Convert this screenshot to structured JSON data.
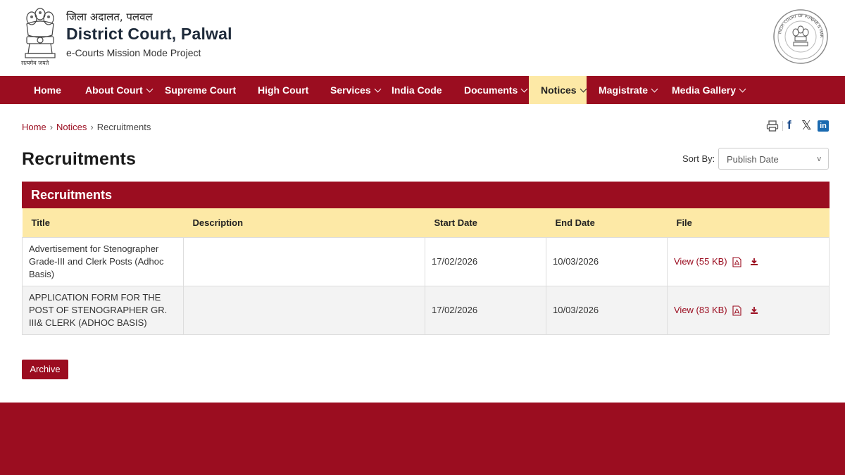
{
  "header": {
    "hindi_title": "जिला अदालत, पलवल",
    "title": "District Court, Palwal",
    "subtitle": "e-Courts Mission Mode Project",
    "emblem_motto": "सत्यमेव जयते"
  },
  "nav": {
    "items": [
      {
        "label": "Home",
        "has_dropdown": false
      },
      {
        "label": "About Court",
        "has_dropdown": true
      },
      {
        "label": "Supreme Court",
        "has_dropdown": false
      },
      {
        "label": "High Court",
        "has_dropdown": false
      },
      {
        "label": "Services",
        "has_dropdown": true
      },
      {
        "label": "India Code",
        "has_dropdown": false
      },
      {
        "label": "Documents",
        "has_dropdown": true
      },
      {
        "label": "Notices",
        "has_dropdown": true,
        "active": true
      },
      {
        "label": "Magistrate",
        "has_dropdown": true
      },
      {
        "label": "Media Gallery",
        "has_dropdown": true
      }
    ]
  },
  "breadcrumb": {
    "home": "Home",
    "notices": "Notices",
    "current": "Recruitments",
    "separator": "›"
  },
  "share": {
    "print_icon": "printer-icon",
    "facebook": "f",
    "x": "𝕏",
    "linkedin": "in"
  },
  "page": {
    "title": "Recruitments",
    "sort_label": "Sort By:",
    "sort_value": "Publish Date",
    "sort_caret": "v"
  },
  "table": {
    "panel_title": "Recruitments",
    "headers": {
      "title": "Title",
      "description": "Description",
      "start_date": "Start Date",
      "end_date": "End Date",
      "file": "File"
    },
    "rows": [
      {
        "title": "Advertisement for Stenographer Grade-III and Clerk Posts (Adhoc Basis)",
        "description": "",
        "start_date": "17/02/2026",
        "end_date": "10/03/2026",
        "file": "View (55 KB)"
      },
      {
        "title": "APPLICATION FORM FOR THE POST OF STENOGRAPHER GR. III& CLERK (ADHOC BASIS)",
        "description": "",
        "start_date": "17/02/2026",
        "end_date": "10/03/2026",
        "file": "View (83 KB)"
      }
    ]
  },
  "archive_label": "Archive",
  "colors": {
    "brand_maroon": "#9b0d20",
    "highlight_yellow": "#fde9a6"
  }
}
